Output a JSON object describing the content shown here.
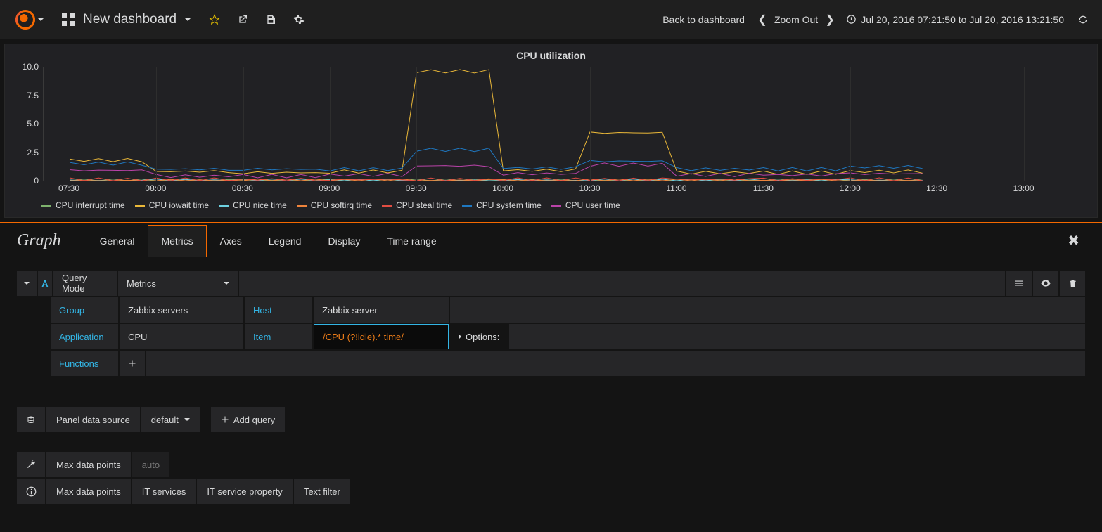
{
  "nav": {
    "dashboard_title": "New dashboard",
    "back_link": "Back to dashboard",
    "zoom_out": "Zoom Out",
    "time_range": "Jul 20, 2016 07:21:50 to Jul 20, 2016 13:21:50"
  },
  "panel": {
    "title": "CPU utilization"
  },
  "chart_data": {
    "type": "line",
    "title": "CPU utilization",
    "ylim": [
      0,
      10
    ],
    "yticks": [
      0,
      2.5,
      5.0,
      7.5,
      10.0
    ],
    "x_categories": [
      "07:30",
      "08:00",
      "08:30",
      "09:00",
      "09:30",
      "10:00",
      "10:30",
      "11:00",
      "11:30",
      "12:00",
      "12:30",
      "13:00"
    ],
    "series": [
      {
        "name": "CPU interrupt time",
        "color": "#7eb26d",
        "values": [
          0,
          0,
          0,
          0,
          0,
          0,
          0,
          0,
          0,
          0
        ]
      },
      {
        "name": "CPU iowait time",
        "color": "#eab839",
        "values": [
          1.8,
          0.8,
          0.7,
          0.8,
          9.6,
          0.9,
          4.2,
          0.7,
          0.7,
          0.8
        ]
      },
      {
        "name": "CPU nice time",
        "color": "#6ed0e0",
        "values": [
          0,
          0,
          0,
          0,
          0,
          0,
          0,
          0,
          0,
          0
        ]
      },
      {
        "name": "CPU softirq time",
        "color": "#ef843c",
        "values": [
          0,
          0,
          0,
          0,
          0,
          0,
          0,
          0,
          0,
          0
        ]
      },
      {
        "name": "CPU steal time",
        "color": "#e24d42",
        "values": [
          0.1,
          0.1,
          0.1,
          0.1,
          0.1,
          0.1,
          0.1,
          0.1,
          0.1,
          0.1
        ]
      },
      {
        "name": "CPU system time",
        "color": "#1f78c1",
        "values": [
          1.5,
          1.0,
          1.0,
          1.0,
          2.7,
          1.1,
          1.7,
          1.0,
          1.0,
          1.2
        ]
      },
      {
        "name": "CPU user time",
        "color": "#ba43a9",
        "values": [
          0.9,
          0.4,
          0.4,
          0.5,
          1.3,
          0.6,
          1.4,
          0.5,
          0.5,
          0.6
        ]
      }
    ]
  },
  "editor": {
    "title": "Graph",
    "tabs": [
      "General",
      "Metrics",
      "Axes",
      "Legend",
      "Display",
      "Time range"
    ],
    "active_tab": "Metrics"
  },
  "query": {
    "letter": "A",
    "mode_label": "Query Mode",
    "mode_value": "Metrics",
    "group_label": "Group",
    "group_value": "Zabbix servers",
    "host_label": "Host",
    "host_value": "Zabbix server",
    "application_label": "Application",
    "application_value": "CPU",
    "item_label": "Item",
    "item_value": "/CPU (?!idle).* time/",
    "options_label": "Options:",
    "functions_label": "Functions"
  },
  "datasource": {
    "label": "Panel data source",
    "value": "default",
    "add_query": "Add query"
  },
  "footer": {
    "max_data_points_label": "Max data points",
    "auto": "auto",
    "row2": [
      "Max data points",
      "IT services",
      "IT service property",
      "Text filter"
    ]
  }
}
